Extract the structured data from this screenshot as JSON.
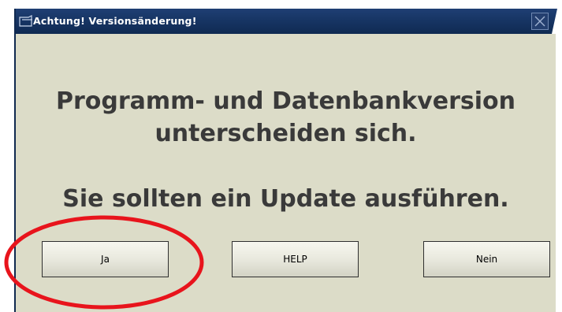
{
  "window": {
    "title": "Achtung! Versionsänderung!",
    "title_icon": "dialog-window-icon",
    "close_icon": "close-icon"
  },
  "message": {
    "line1": "Programm- und Datenbankversion",
    "line2": "unterscheiden sich.",
    "line3": "Sie sollten ein Update ausführen."
  },
  "buttons": {
    "yes_label": "Ja",
    "help_label": "HELP",
    "no_label": "Nein"
  },
  "colors": {
    "titlebar": "#173564",
    "dialog_background": "#dcdcc8",
    "message_text": "#3a3a3a",
    "annotation": "#e8141c"
  }
}
